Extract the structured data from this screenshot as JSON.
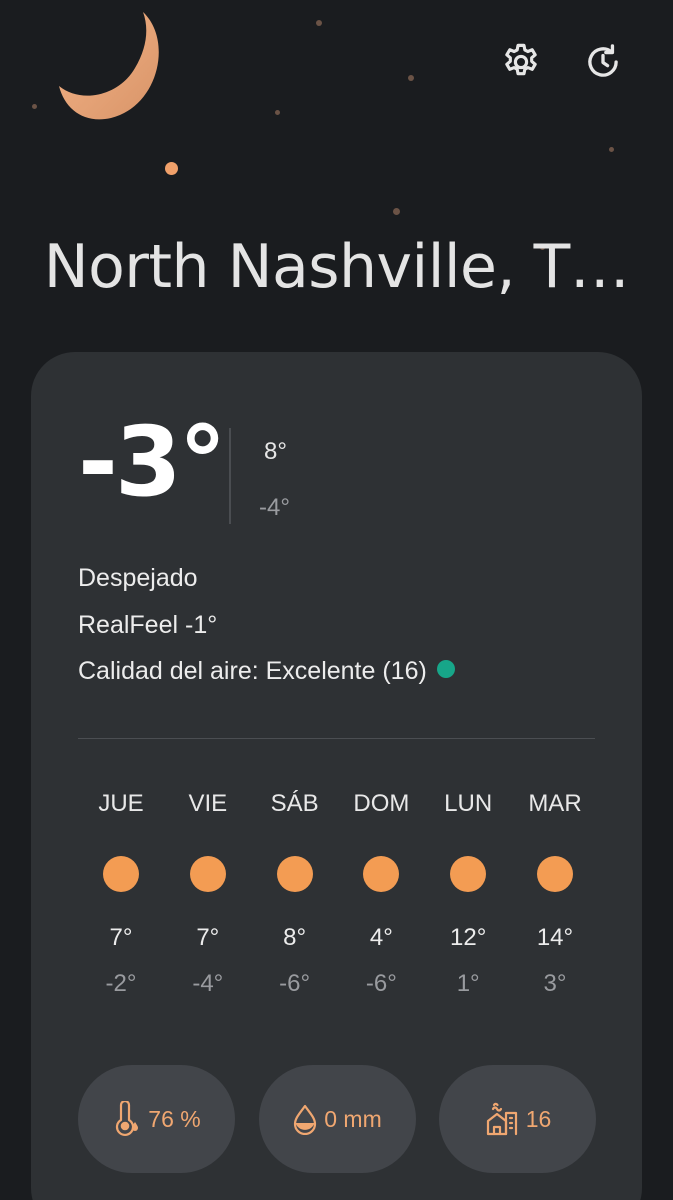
{
  "header": {
    "city": "North Nashville, T…"
  },
  "current": {
    "temperature": "-3°",
    "high": "8°",
    "low": "-4°",
    "condition": "Despejado",
    "realfeel": "RealFeel -1°",
    "air_quality": "Calidad del aire: Excelente (16)",
    "air_quality_color": "#17a689"
  },
  "forecast": [
    {
      "day": "JUE",
      "high": "7°",
      "low": "-2°",
      "icon": "sun-icon"
    },
    {
      "day": "VIE",
      "high": "7°",
      "low": "-4°",
      "icon": "sun-icon"
    },
    {
      "day": "SÁB",
      "high": "8°",
      "low": "-6°",
      "icon": "sun-icon"
    },
    {
      "day": "DOM",
      "high": "4°",
      "low": "-6°",
      "icon": "sun-icon"
    },
    {
      "day": "LUN",
      "high": "12°",
      "low": "1°",
      "icon": "sun-icon"
    },
    {
      "day": "MAR",
      "high": "14°",
      "low": "3°",
      "icon": "sun-icon"
    }
  ],
  "stats": {
    "humidity": "76 %",
    "precipitation": "0 mm",
    "air_index": "16"
  },
  "icons": {
    "settings": "gear-icon",
    "refresh": "refresh-clock-icon",
    "moon": "moon-icon",
    "humidity": "thermometer-drop-icon",
    "precipitation": "water-drop-icon",
    "air_index": "building-air-icon"
  },
  "colors": {
    "background": "#1a1c1f",
    "card": "#2e3134",
    "accent": "#f39c53",
    "moon": "#e4a078"
  }
}
